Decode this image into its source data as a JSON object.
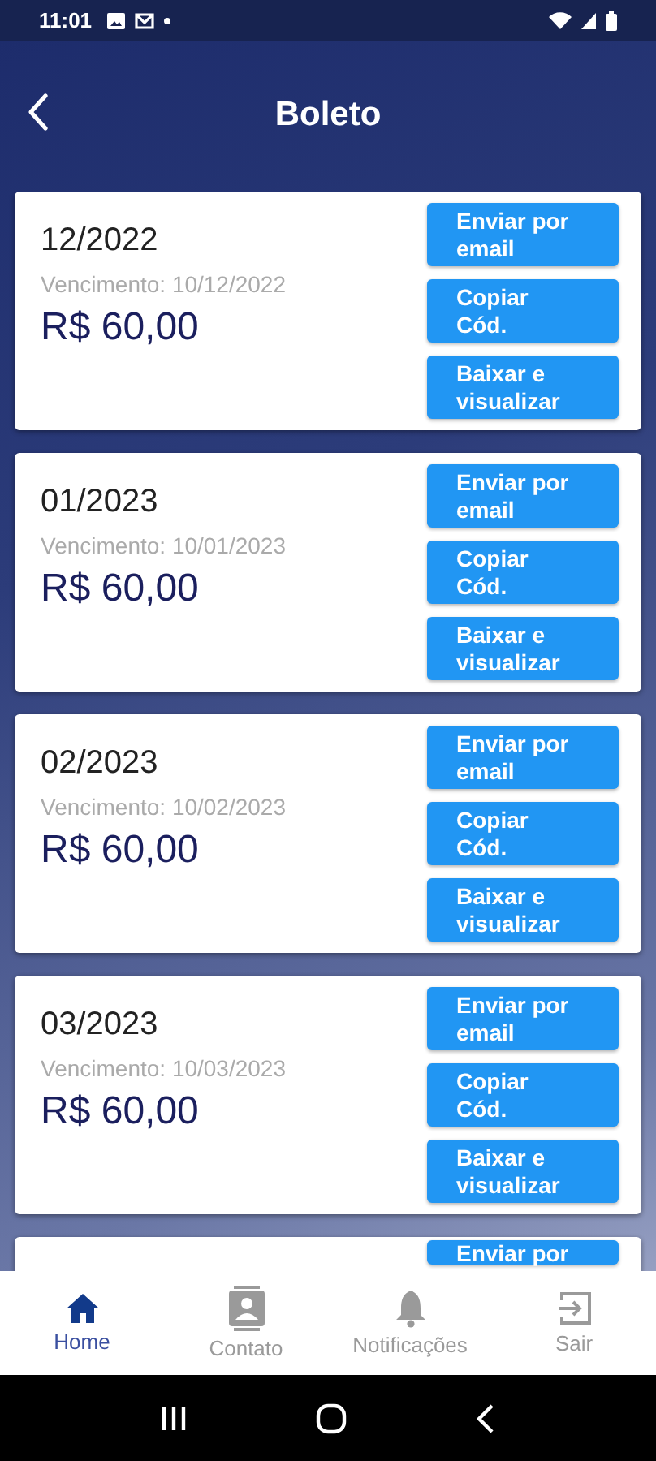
{
  "status_bar": {
    "time": "11:01"
  },
  "header": {
    "title": "Boleto"
  },
  "boletos": [
    {
      "month": "12/2022",
      "due": "Vencimento: 10/12/2022",
      "amount": "R$ 60,00",
      "actions": [
        "Enviar por email",
        "Copiar Cód.",
        "Baixar e visualizar"
      ]
    },
    {
      "month": "01/2023",
      "due": "Vencimento: 10/01/2023",
      "amount": "R$ 60,00",
      "actions": [
        "Enviar por email",
        "Copiar Cód.",
        "Baixar e visualizar"
      ]
    },
    {
      "month": "02/2023",
      "due": "Vencimento: 10/02/2023",
      "amount": "R$ 60,00",
      "actions": [
        "Enviar por email",
        "Copiar Cód.",
        "Baixar e visualizar"
      ]
    },
    {
      "month": "03/2023",
      "due": "Vencimento: 10/03/2023",
      "amount": "R$ 60,00",
      "actions": [
        "Enviar por email",
        "Copiar Cód.",
        "Baixar e visualizar"
      ]
    },
    {
      "actions": [
        "Enviar por"
      ]
    }
  ],
  "nav": [
    {
      "kind": "home",
      "label": "Home",
      "selected": true
    },
    {
      "kind": "contact",
      "label": "Contato",
      "selected": false
    },
    {
      "kind": "bell",
      "label": "Notificações",
      "selected": false
    },
    {
      "kind": "exit",
      "label": "Sair",
      "selected": false
    }
  ]
}
